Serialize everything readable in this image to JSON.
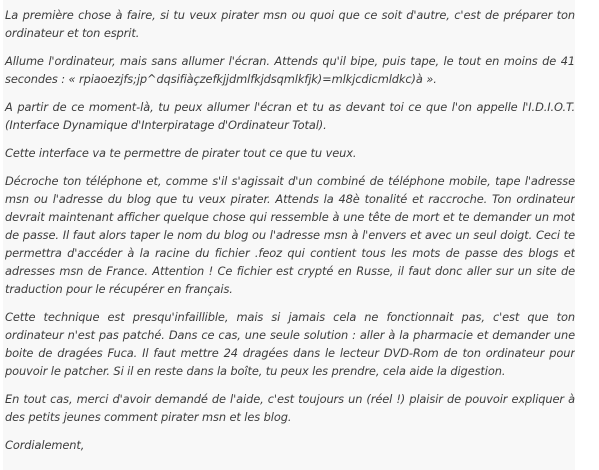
{
  "article": {
    "paragraphs": [
      "La première chose à faire, si tu veux pirater msn ou quoi que ce soit d'autre, c'est de préparer ton ordinateur et ton esprit.",
      "Allume l'ordinateur, mais sans allumer l'écran. Attends qu'il bipe, puis tape, le tout en moins de 41 secondes : « rpiaoezjfs;jp^dqsifiàçzefkjjdmlfkjdsqmlkfjk)=mlkjcdicmldkc)à ».",
      "A partir de ce moment-là, tu peux allumer l'écran et tu as devant toi ce que l'on appelle l'I.D.I.O.T. (Interface Dynamique d'Interpiratage d'Ordinateur Total).",
      "Cette interface va te permettre de pirater tout ce que tu veux.",
      "Décroche ton téléphone et, comme s'il s'agissait d'un combiné de téléphone mobile, tape l'adresse msn ou l'adresse du blog que tu veux pirater. Attends la 48è tonalité et raccroche. Ton ordinateur devrait maintenant afficher quelque chose qui ressemble à une tête de mort et te demander un mot de passe. Il faut alors taper le nom du blog ou l'adresse msn à l'envers et avec un seul doigt. Ceci te permettra d'accéder à la racine du fichier .feoz qui contient tous les mots de passe des blogs et adresses msn de France. Attention ! Ce fichier est crypté en Russe, il faut donc aller sur un site de traduction pour le récupérer en français.",
      "Cette technique est presqu'infaillible, mais si jamais cela ne fonctionnait pas, c'est que ton ordinateur n'est pas patché. Dans ce cas, une seule solution : aller à la pharmacie et demander une boite de dragées Fuca. Il faut mettre 24 dragées dans le lecteur DVD-Rom de ton ordinateur pour pouvoir le patcher. Si il en reste dans la boîte, tu peux les prendre, cela aide la digestion.",
      "En tout cas, merci d'avoir demandé de l'aide, c'est toujours un (réel !) plaisir de pouvoir expliquer à des petits jeunes comment pirater msn et les blog."
    ],
    "signoff": "Cordialement,"
  }
}
